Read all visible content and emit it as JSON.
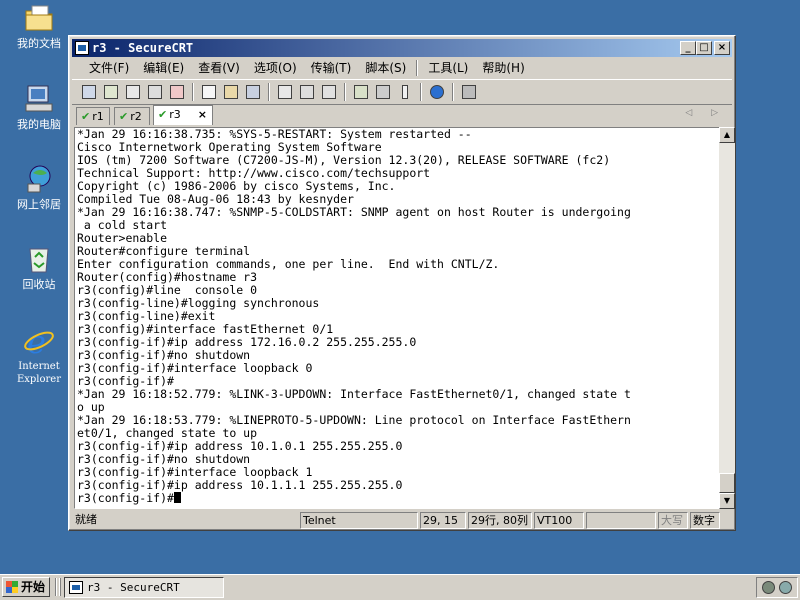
{
  "desktop": {
    "icons": [
      {
        "label": "我的文档",
        "icon": "my-documents-icon"
      },
      {
        "label": "我的电脑",
        "icon": "my-computer-icon"
      },
      {
        "label": "网上邻居",
        "icon": "network-places-icon"
      },
      {
        "label": "回收站",
        "icon": "recycle-bin-icon"
      },
      {
        "label": "Internet Explorer",
        "icon": "internet-explorer-icon"
      }
    ]
  },
  "window": {
    "title": "r3 - SecureCRT",
    "controls": {
      "minimize": "_",
      "maximize": "□",
      "close": "×"
    }
  },
  "menu": {
    "items": [
      "文件(F)",
      "编辑(E)",
      "查看(V)",
      "选项(O)",
      "传输(T)",
      "脚本(S)",
      "工具(L)",
      "帮助(H)"
    ]
  },
  "tabs": {
    "items": [
      {
        "label": "r1",
        "active": false
      },
      {
        "label": "r2",
        "active": false
      },
      {
        "label": "r3",
        "active": true
      }
    ],
    "close": "×",
    "arrows": "◁ ▷"
  },
  "terminal": {
    "lines": [
      "*Jan 29 16:16:38.735: %SYS-5-RESTART: System restarted --",
      "Cisco Internetwork Operating System Software",
      "IOS (tm) 7200 Software (C7200-JS-M), Version 12.3(20), RELEASE SOFTWARE (fc2)",
      "Technical Support: http://www.cisco.com/techsupport",
      "Copyright (c) 1986-2006 by cisco Systems, Inc.",
      "Compiled Tue 08-Aug-06 18:43 by kesnyder",
      "*Jan 29 16:16:38.747: %SNMP-5-COLDSTART: SNMP agent on host Router is undergoing",
      " a cold start",
      "Router>enable",
      "Router#configure terminal",
      "Enter configuration commands, one per line.  End with CNTL/Z.",
      "Router(config)#hostname r3",
      "r3(config)#line  console 0",
      "r3(config-line)#logging synchronous",
      "r3(config-line)#exit",
      "r3(config)#interface fastEthernet 0/1",
      "r3(config-if)#ip address 172.16.0.2 255.255.255.0",
      "r3(config-if)#no shutdown",
      "r3(config-if)#interface loopback 0",
      "r3(config-if)#",
      "*Jan 29 16:18:52.779: %LINK-3-UPDOWN: Interface FastEthernet0/1, changed state t",
      "o up",
      "*Jan 29 16:18:53.779: %LINEPROTO-5-UPDOWN: Line protocol on Interface FastEthern",
      "et0/1, changed state to up",
      "r3(config-if)#ip address 10.1.0.1 255.255.255.0",
      "r3(config-if)#no shutdown",
      "r3(config-if)#interface loopback 1",
      "r3(config-if)#ip address 10.1.1.1 255.255.255.0"
    ],
    "prompt": "r3(config-if)#"
  },
  "status": {
    "ready": "就绪",
    "protocol": "Telnet",
    "cursor_pos": "29, 15",
    "size": "29行, 80列",
    "emulation": "VT100",
    "empty": "",
    "caps": "大写",
    "num": "数字"
  },
  "taskbar": {
    "start": "开始",
    "task": "r3 - SecureCRT"
  }
}
